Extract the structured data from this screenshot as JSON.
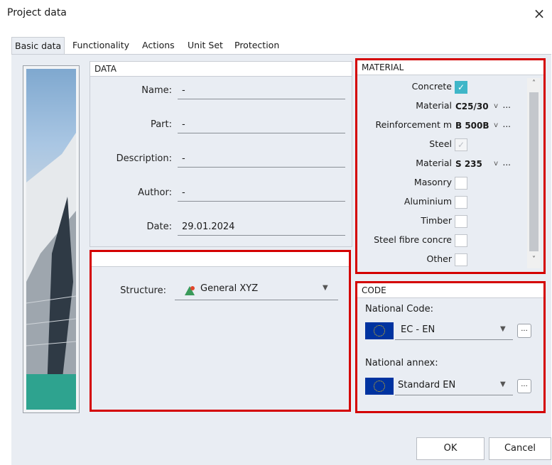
{
  "window": {
    "title": "Project data",
    "close": "×"
  },
  "tabs": [
    {
      "label": "Basic data"
    },
    {
      "label": "Functionality"
    },
    {
      "label": "Actions"
    },
    {
      "label": "Unit Set"
    },
    {
      "label": "Protection"
    }
  ],
  "data_panel": {
    "header": "DATA",
    "name": {
      "label": "Name:",
      "value": "-"
    },
    "part": {
      "label": "Part:",
      "value": "-"
    },
    "description": {
      "label": "Description:",
      "value": "-"
    },
    "author": {
      "label": "Author:",
      "value": "-"
    },
    "date": {
      "label": "Date:",
      "value": "29.01.2024"
    }
  },
  "structure": {
    "label": "Structure:",
    "value": "General XYZ",
    "icon": "structure-icon"
  },
  "material_panel": {
    "header": "MATERIAL",
    "rows": [
      {
        "label": "Concrete",
        "type": "checkbox",
        "checked": true
      },
      {
        "label": "Material",
        "type": "select",
        "value": "C25/30",
        "arrow": "v",
        "more": "..."
      },
      {
        "label": "Reinforcement m",
        "type": "select",
        "value": "B 500B",
        "arrow": "v",
        "more": "..."
      },
      {
        "label": "Steel",
        "type": "checkbox",
        "checked": true,
        "disabled": true
      },
      {
        "label": "Material",
        "type": "select",
        "value": "S 235",
        "arrow": "v",
        "more": "..."
      },
      {
        "label": "Masonry",
        "type": "checkbox",
        "checked": false
      },
      {
        "label": "Aluminium",
        "type": "checkbox",
        "checked": false
      },
      {
        "label": "Timber",
        "type": "checkbox",
        "checked": false
      },
      {
        "label": "Steel fibre concre",
        "type": "checkbox",
        "checked": false
      },
      {
        "label": "Other",
        "type": "checkbox",
        "checked": false
      }
    ]
  },
  "code_panel": {
    "header": "CODE",
    "national_code": {
      "label": "National Code:",
      "value": "EC - EN",
      "more": "..."
    },
    "national_annex": {
      "label": "National annex:",
      "value": "Standard EN",
      "more": "..."
    }
  },
  "buttons": {
    "ok": "OK",
    "cancel": "Cancel"
  },
  "colors": {
    "highlight_border": "#d40000",
    "check_accent": "#3fb6c8",
    "flag_blue": "#0033a0",
    "panel_bg": "#e9edf3"
  }
}
